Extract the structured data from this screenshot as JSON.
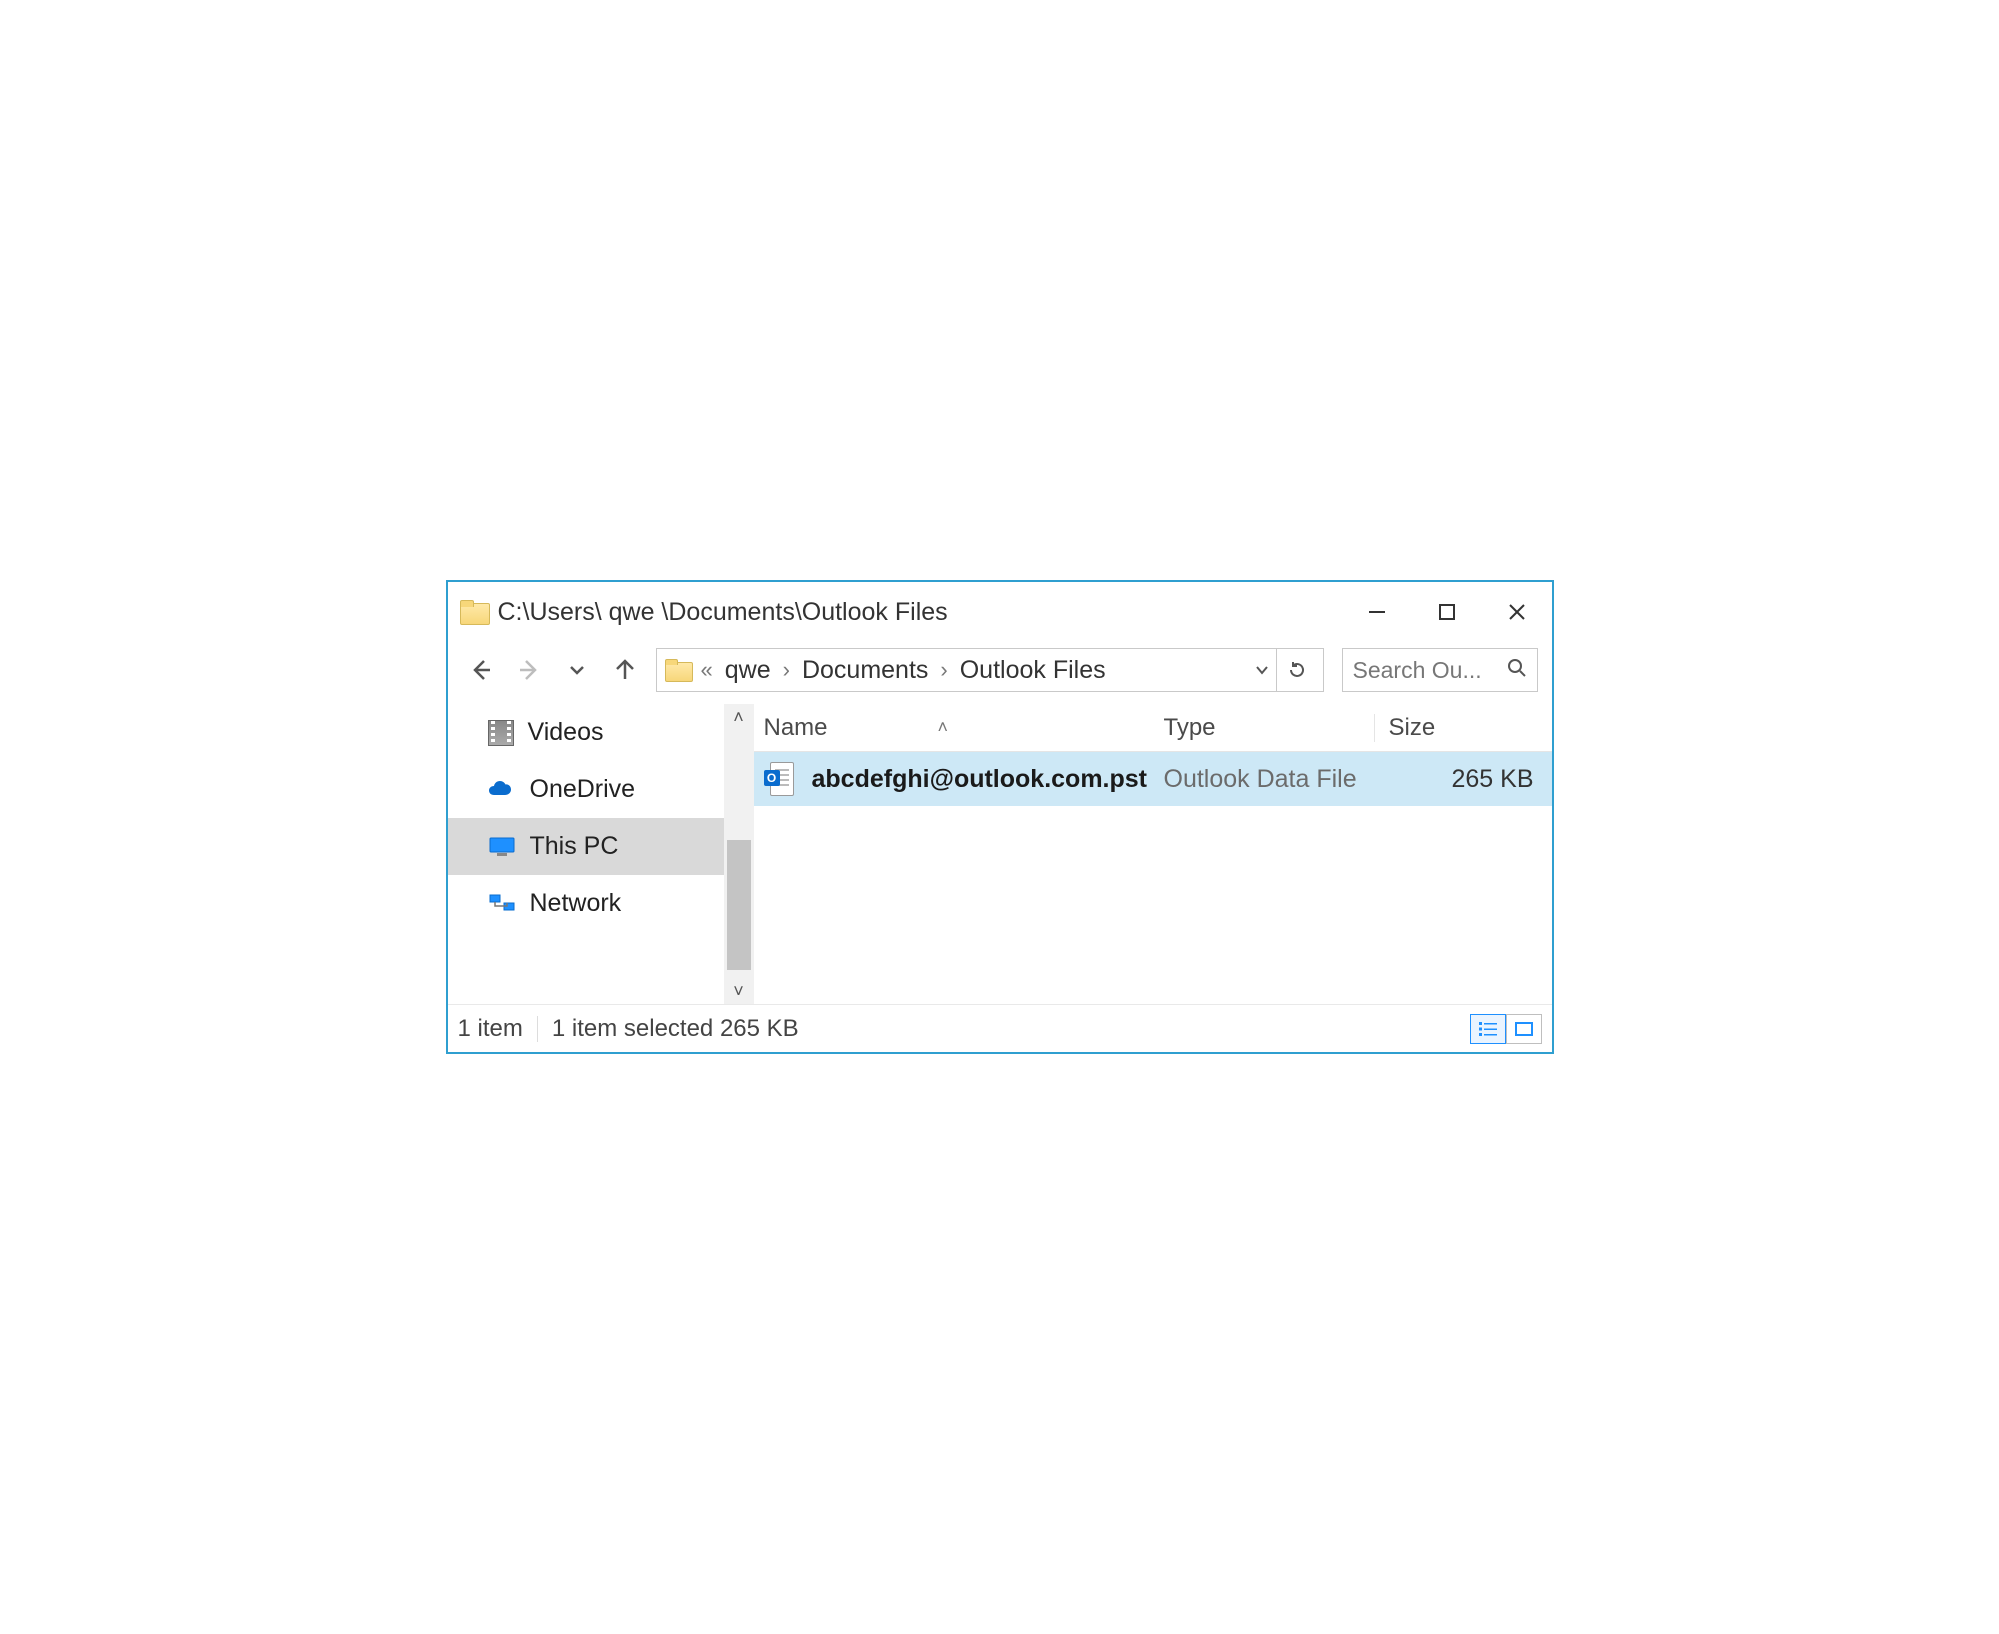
{
  "window": {
    "title": "C:\\Users\\ qwe \\Documents\\Outlook Files"
  },
  "breadcrumbs": {
    "overflow_glyph": "«",
    "items": [
      "qwe",
      "Documents",
      "Outlook Files"
    ]
  },
  "search": {
    "placeholder": "Search Ou..."
  },
  "sidebar": {
    "items": [
      {
        "label": "Videos",
        "icon": "videos-icon",
        "selected": false
      },
      {
        "label": "OneDrive",
        "icon": "onedrive-icon",
        "selected": false
      },
      {
        "label": "This PC",
        "icon": "thispc-icon",
        "selected": true
      },
      {
        "label": "Network",
        "icon": "network-icon",
        "selected": false
      }
    ]
  },
  "columns": {
    "name": "Name",
    "type": "Type",
    "size": "Size"
  },
  "files": [
    {
      "name": "abcdefghi@outlook.com.pst",
      "type": "Outlook Data File",
      "size": "265 KB",
      "selected": true,
      "icon": "outlook-pst-icon"
    }
  ],
  "status": {
    "count_text": "1 item",
    "selection_text": "1 item selected  265 KB"
  }
}
